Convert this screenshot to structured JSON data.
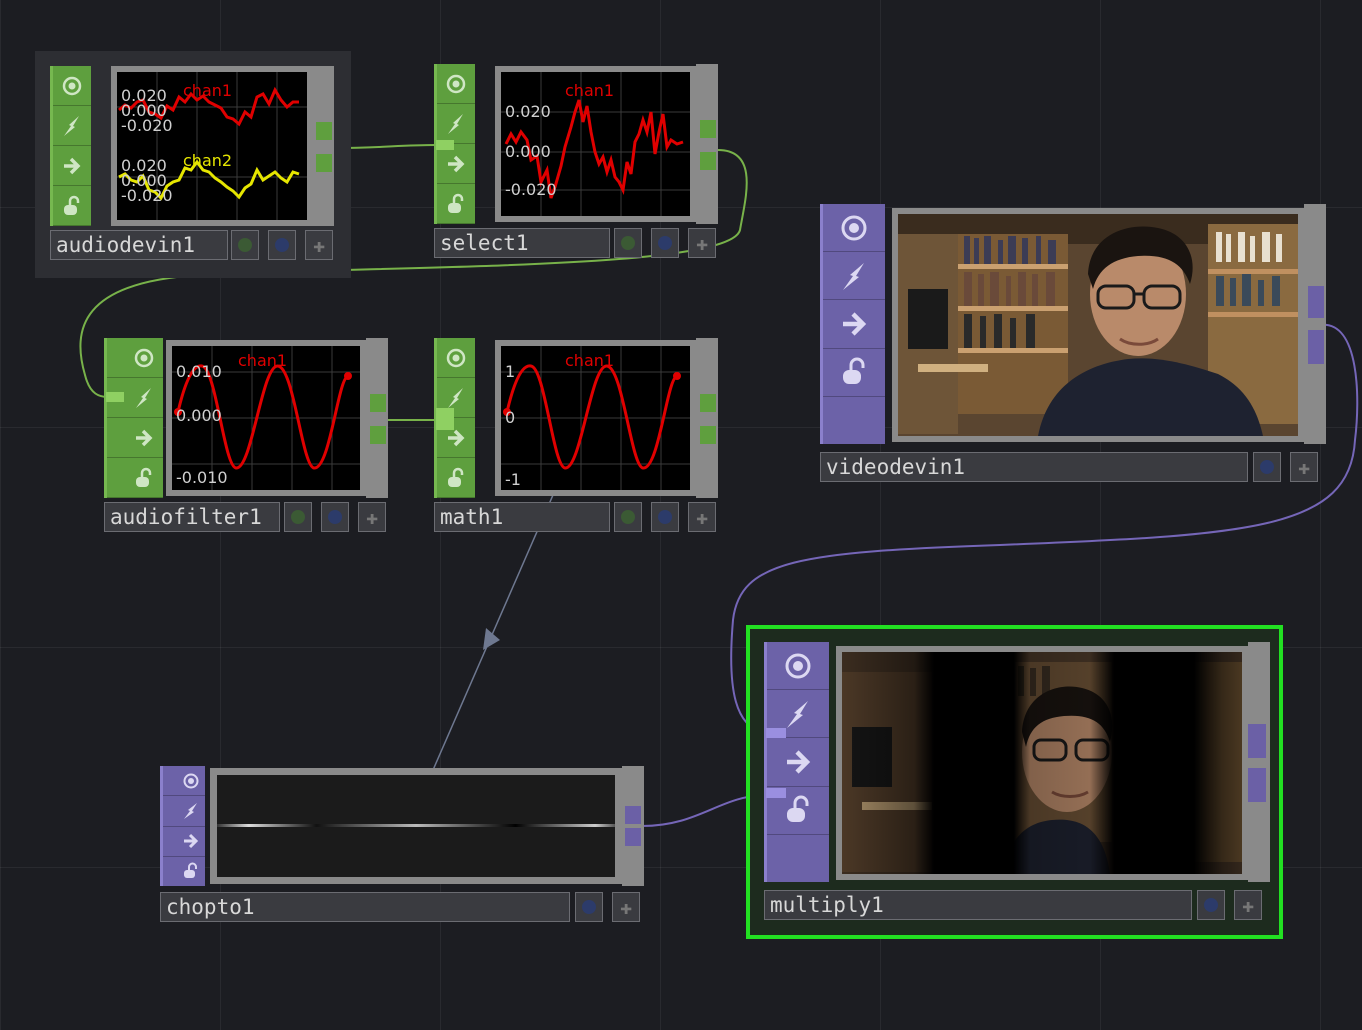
{
  "colors": {
    "background": "#1c1d22",
    "chop_family": "#5e9f3e",
    "top_family": "#6c62a8",
    "selection": "#22e022",
    "wave_red": "#e00000",
    "wave_yellow": "#e6e600"
  },
  "icons": [
    "viewer-toggle-icon",
    "lightning-icon",
    "arrow-right-icon",
    "lock-icon",
    "plus-icon"
  ],
  "nodes": {
    "audiodevin1": {
      "name": "audiodevin1",
      "channels": [
        {
          "name": "chan1",
          "top": "0.020",
          "mid": "0.000",
          "bot": "-0.020"
        },
        {
          "name": "chan2",
          "top": "0.020",
          "mid": "0.000",
          "bot": "-0.020"
        }
      ]
    },
    "select1": {
      "name": "select1",
      "chan": "chan1",
      "top": "0.020",
      "mid": "0.000",
      "bot": "-0.020"
    },
    "audiofilter1": {
      "name": "audiofilter1",
      "chan": "chan1",
      "top": "0.010",
      "mid": "0.000",
      "bot": "-0.010"
    },
    "math1": {
      "name": "math1",
      "chan": "chan1",
      "top": "1",
      "mid": "0",
      "bot": "-1"
    },
    "videodevin1": {
      "name": "videodevin1"
    },
    "chopto1": {
      "name": "chopto1"
    },
    "multiply1": {
      "name": "multiply1",
      "selected": true
    }
  }
}
